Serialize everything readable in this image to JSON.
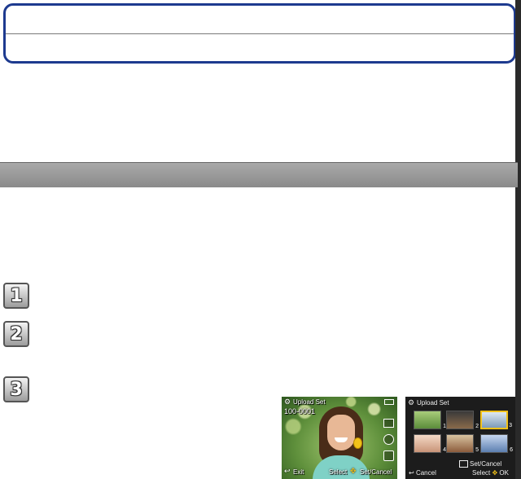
{
  "header": {
    "top_text": "",
    "bottom_text": ""
  },
  "section": {
    "title": ""
  },
  "steps": [
    "1",
    "2",
    "3"
  ],
  "screen1": {
    "mode_title": "Upload Set",
    "file_number": "100-0001",
    "exit_label": "Exit",
    "select_label": "Select",
    "set_cancel_label": "Set/Cancel"
  },
  "screen2": {
    "mode_title": "Upload Set",
    "thumb_numbers": [
      "1",
      "2",
      "3",
      "4",
      "5",
      "6"
    ],
    "cancel_label": "Cancel",
    "set_cancel_label": "Set/Cancel",
    "select_label": "Select",
    "ok_label": "OK"
  },
  "colors": {
    "frame_blue": "#1d3a8f",
    "section_gray": "#9a9a9a",
    "selection_yellow": "#f2c21a"
  }
}
